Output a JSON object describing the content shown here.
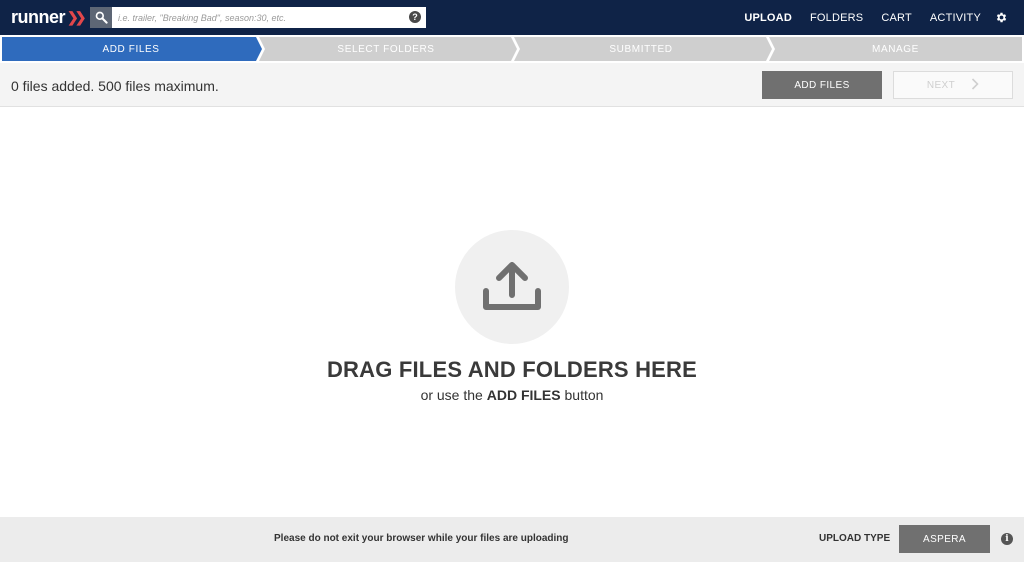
{
  "brand": {
    "logo_text": "runner",
    "logo_mark": "»"
  },
  "search": {
    "icon": "search-icon",
    "placeholder": "i.e. trailer, \"Breaking Bad\", season:30, etc.",
    "help_label": "?"
  },
  "nav": {
    "upload": "UPLOAD",
    "folders": "FOLDERS",
    "cart": "CART",
    "activity": "ACTIVITY",
    "settings_icon": "gear-icon"
  },
  "steps": [
    {
      "label": "ADD FILES",
      "state": "active"
    },
    {
      "label": "SELECT FOLDERS",
      "state": "inactive"
    },
    {
      "label": "SUBMITTED",
      "state": "inactive"
    },
    {
      "label": "MANAGE",
      "state": "inactive"
    }
  ],
  "toolbar": {
    "count_text": "0 files added. 500 files maximum.",
    "add_files_label": "ADD FILES",
    "next_label": "NEXT",
    "next_arrow": "›"
  },
  "dropzone": {
    "icon": "upload-icon",
    "title": "DRAG FILES AND FOLDERS HERE",
    "sub_prefix": "or use the ",
    "sub_bold": "ADD FILES",
    "sub_suffix": " button"
  },
  "footer": {
    "message": "Please do not exit your browser while your files are uploading",
    "upload_type_label": "UPLOAD TYPE",
    "upload_type_value": "ASPERA",
    "info_label": "i"
  },
  "colors": {
    "topbar": "#0f2347",
    "step_active": "#2f6bbd",
    "step_inactive": "#cfcfcf",
    "button_gray": "#707070",
    "logo_accent": "#e2474b"
  }
}
